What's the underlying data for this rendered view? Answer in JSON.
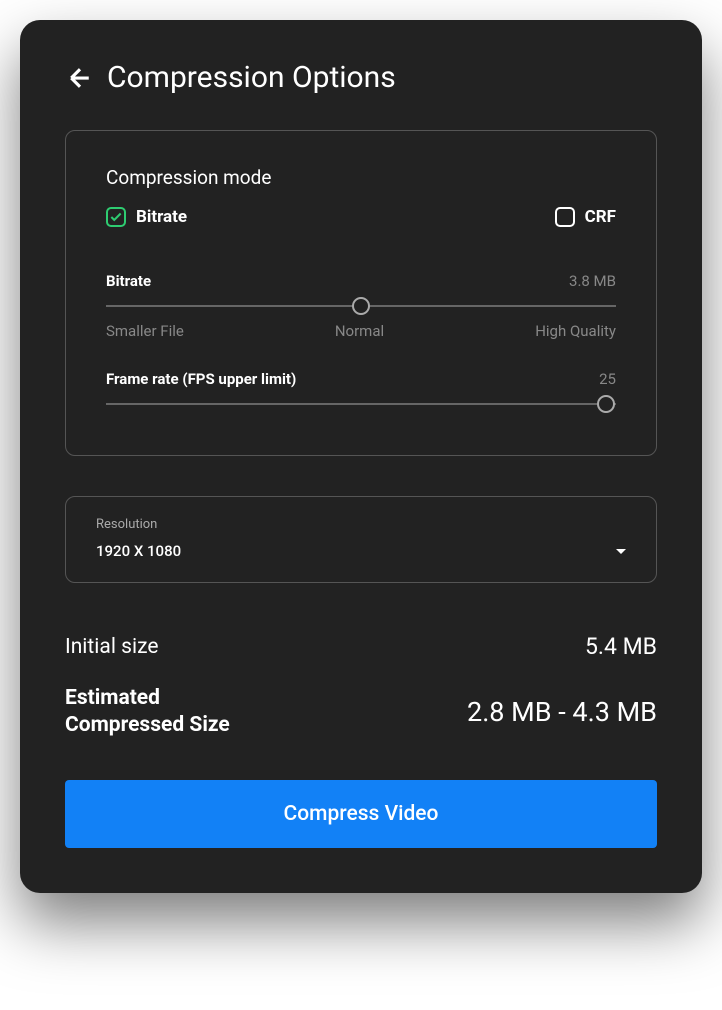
{
  "header": {
    "title": "Compression Options"
  },
  "compression": {
    "modeLabel": "Compression mode",
    "options": {
      "bitrate": "Bitrate",
      "crf": "CRF"
    },
    "bitrateSlider": {
      "label": "Bitrate",
      "value": "3.8 MB",
      "leftLabel": "Smaller File",
      "centerLabel": "Normal",
      "rightLabel": "High Quality",
      "position": 50
    },
    "frameRateSlider": {
      "label": "Frame rate (FPS upper limit)",
      "value": "25",
      "position": 98
    }
  },
  "resolution": {
    "label": "Resolution",
    "value": "1920 X 1080"
  },
  "sizes": {
    "initialLabel": "Initial size",
    "initialValue": "5.4 MB",
    "estimatedLabel1": "Estimated",
    "estimatedLabel2": "Compressed Size",
    "estimatedValue": "2.8 MB - 4.3 MB"
  },
  "button": {
    "compress": "Compress Video"
  }
}
